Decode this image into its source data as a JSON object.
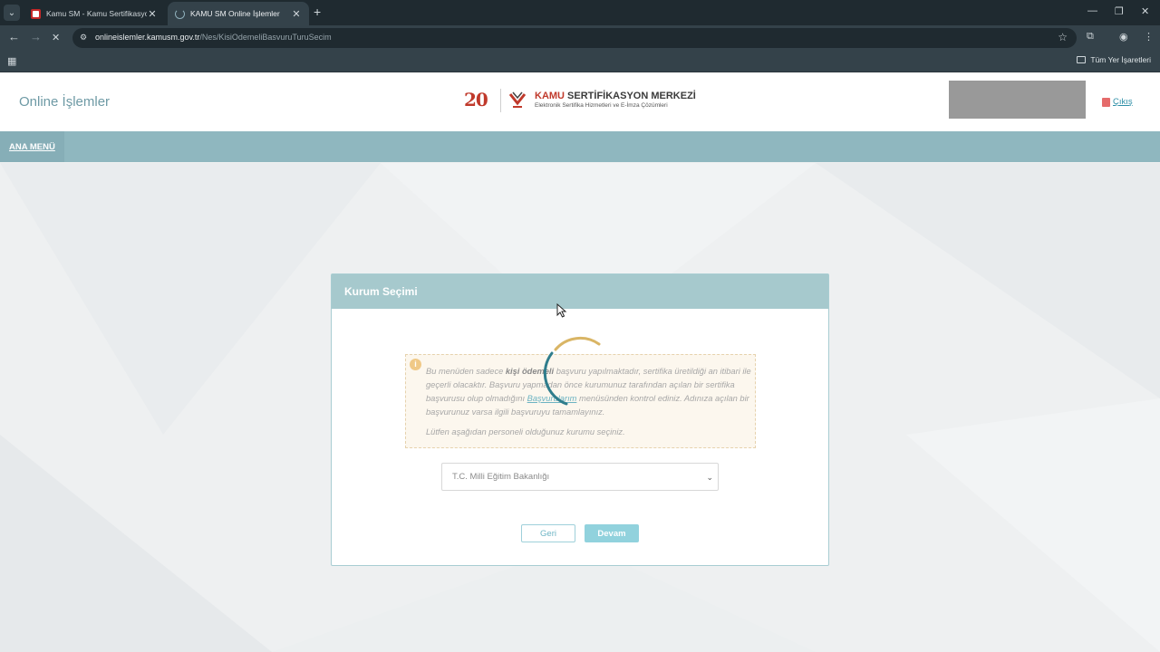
{
  "browser": {
    "tabs": [
      {
        "title": "Kamu SM - Kamu Sertifikasyon",
        "active": false
      },
      {
        "title": "KAMU SM Online İşlemler",
        "active": true
      }
    ],
    "url_host": "onlineislemler.kamusm.gov.tr",
    "url_path": "/Nes/KisiOdemeliBasvuruTuruSecim",
    "bookmarks_label": "Tüm Yer İşaretleri"
  },
  "header": {
    "site_title": "Online İşlemler",
    "logo_anniversary": "20",
    "logo_org_accent": "KAMU",
    "logo_org_rest": " SERTİFİKASYON MERKEZİ",
    "logo_tagline": "Elektronik Sertifika Hizmetleri ve E-İmza Çözümleri",
    "logout_label": "Çıkış"
  },
  "menu": {
    "main_menu": "ANA MENÜ"
  },
  "card": {
    "title": "Kurum Seçimi",
    "notice": {
      "part1": "Bu menüden sadece ",
      "bold": "kişi ödemeli",
      "part2": " başvuru yapılmaktadır, sertifika üretildiği an itibari ile geçerli olacaktır. Başvuru yapmadan önce kurumunuz tarafından açılan bir sertifika başvurusu olup olmadığını ",
      "link": "Başvurularım",
      "part3": " menüsünden kontrol ediniz. Adınıza açılan bir başvurunuz varsa ilgili başvuruyu tamamlayınız.",
      "paragraph2": "Lütfen aşağıdan personeli olduğunuz kurumu seçiniz."
    },
    "select_value": "T.C. Milli Eğitim Bakanlığı",
    "back_label": "Geri",
    "next_label": "Devam"
  },
  "colors": {
    "menubar": "#8fb7bf",
    "card_header": "#a6c9cd",
    "accent_link": "#2f8fa7",
    "logo_red": "#c0392b"
  }
}
